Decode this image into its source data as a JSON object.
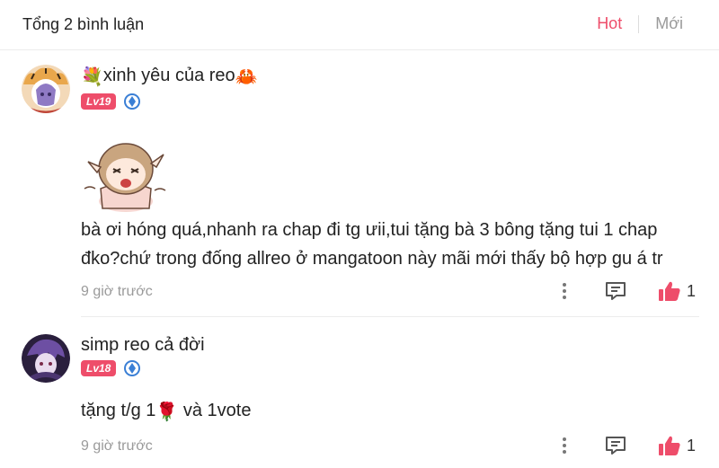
{
  "header": {
    "title": "Tổng 2 bình luận",
    "sort_hot": "Hot",
    "sort_new": "Mới",
    "accent_color": "#ee4d6a"
  },
  "comments": [
    {
      "name_emoji_left": "💐",
      "name": "xinh yêu của reo",
      "name_emoji_right": "🦀",
      "level": "Lv19",
      "sticker": "crying-girl-sticker",
      "text_lines": [
        "bà ơi hóng quá,nhanh ra chap đi tg ưii,tui tặng bà 3 bông tặng tui 1 chap",
        "đko?chứ trong đống allreo ở mangatoon này mãi mới thấy bộ hợp gu á tr"
      ],
      "time": "9 giờ trước",
      "likes": "1"
    },
    {
      "name": "simp reo cả đời",
      "level": "Lv18",
      "text_before": "tặng t/g 1",
      "text_emoji": "🌹",
      "text_after": " và 1vote",
      "time": "9 giờ trước",
      "likes": "1"
    }
  ]
}
